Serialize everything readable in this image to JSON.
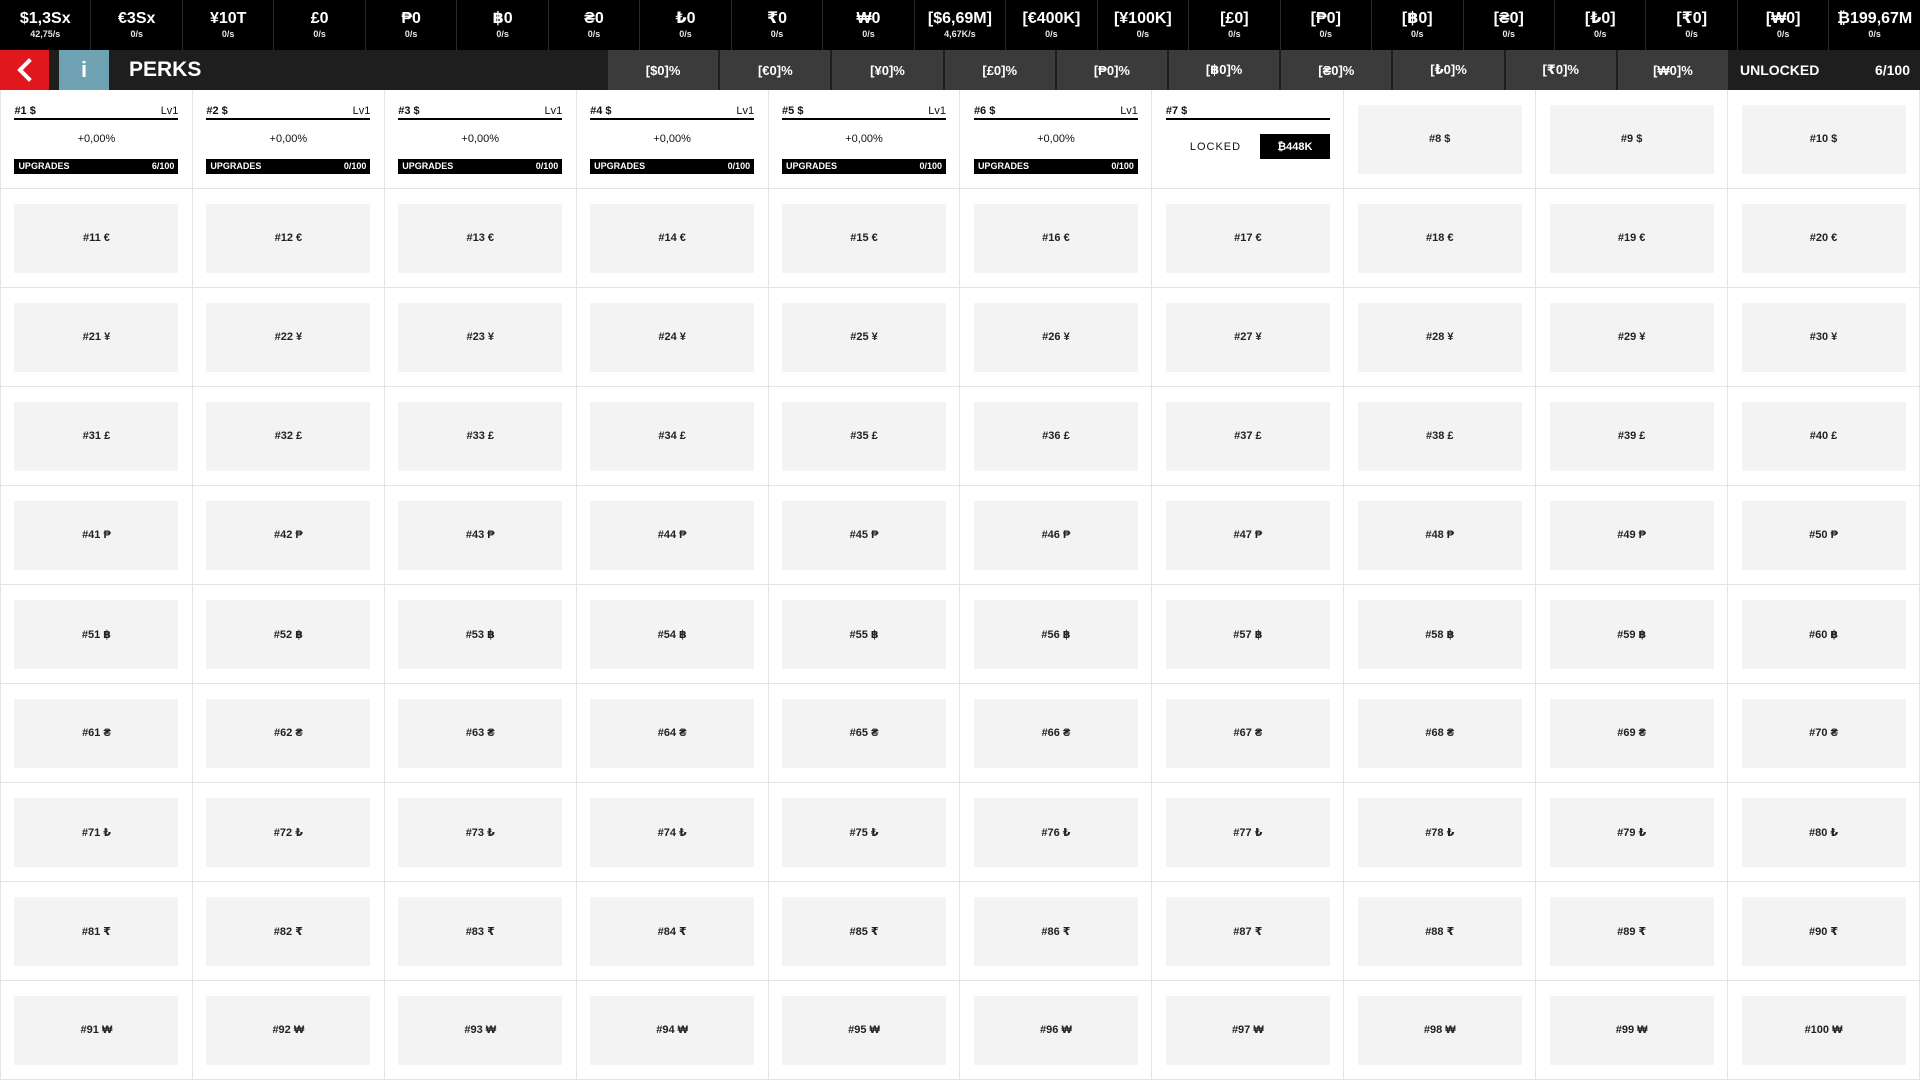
{
  "currencies": [
    {
      "amount": "$1,3Sx",
      "rate": "42,75/s"
    },
    {
      "amount": "€3Sx",
      "rate": "0/s"
    },
    {
      "amount": "¥10T",
      "rate": "0/s"
    },
    {
      "amount": "£0",
      "rate": "0/s"
    },
    {
      "amount": "₱0",
      "rate": "0/s"
    },
    {
      "amount": "฿0",
      "rate": "0/s"
    },
    {
      "amount": "₴0",
      "rate": "0/s"
    },
    {
      "amount": "₺0",
      "rate": "0/s"
    },
    {
      "amount": "₹0",
      "rate": "0/s"
    },
    {
      "amount": "₩0",
      "rate": "0/s"
    },
    {
      "amount": "[$6,69M]",
      "rate": "4,67K/s"
    },
    {
      "amount": "[€400K]",
      "rate": "0/s"
    },
    {
      "amount": "[¥100K]",
      "rate": "0/s"
    },
    {
      "amount": "[£0]",
      "rate": "0/s"
    },
    {
      "amount": "[₱0]",
      "rate": "0/s"
    },
    {
      "amount": "[฿0]",
      "rate": "0/s"
    },
    {
      "amount": "[₴0]",
      "rate": "0/s"
    },
    {
      "amount": "[₺0]",
      "rate": "0/s"
    },
    {
      "amount": "[₹0]",
      "rate": "0/s"
    },
    {
      "amount": "[₩0]",
      "rate": "0/s"
    },
    {
      "amount": "₿199,67M",
      "rate": "0/s"
    }
  ],
  "header": {
    "title": "PERKS",
    "info_label": "i",
    "percentages": [
      "[$0]%",
      "[€0]%",
      "[¥0]%",
      "[£0]%",
      "[₱0]%",
      "[฿0]%",
      "[₴0]%",
      "[₺0]%",
      "[₹0]%",
      "[₩0]%"
    ],
    "unlocked_label": "UNLOCKED",
    "unlocked_value": "6/100"
  },
  "perks": [
    {
      "label": "#1 $",
      "level": "Lv1",
      "bonus": "+0,00%",
      "upgrades_label": "UPGRADES",
      "upgrades": "6/100"
    },
    {
      "label": "#2 $",
      "level": "Lv1",
      "bonus": "+0,00%",
      "upgrades_label": "UPGRADES",
      "upgrades": "0/100"
    },
    {
      "label": "#3 $",
      "level": "Lv1",
      "bonus": "+0,00%",
      "upgrades_label": "UPGRADES",
      "upgrades": "0/100"
    },
    {
      "label": "#4 $",
      "level": "Lv1",
      "bonus": "+0,00%",
      "upgrades_label": "UPGRADES",
      "upgrades": "0/100"
    },
    {
      "label": "#5 $",
      "level": "Lv1",
      "bonus": "+0,00%",
      "upgrades_label": "UPGRADES",
      "upgrades": "0/100"
    },
    {
      "label": "#6 $",
      "level": "Lv1",
      "bonus": "+0,00%",
      "upgrades_label": "UPGRADES",
      "upgrades": "0/100"
    },
    {
      "label": "#7 $",
      "locked_label": "LOCKED",
      "cost": "₿448K"
    },
    {
      "label": "#8 $"
    },
    {
      "label": "#9 $"
    },
    {
      "label": "#10 $"
    },
    {
      "label": "#11 €"
    },
    {
      "label": "#12 €"
    },
    {
      "label": "#13 €"
    },
    {
      "label": "#14 €"
    },
    {
      "label": "#15 €"
    },
    {
      "label": "#16 €"
    },
    {
      "label": "#17 €"
    },
    {
      "label": "#18 €"
    },
    {
      "label": "#19 €"
    },
    {
      "label": "#20 €"
    },
    {
      "label": "#21 ¥"
    },
    {
      "label": "#22 ¥"
    },
    {
      "label": "#23 ¥"
    },
    {
      "label": "#24 ¥"
    },
    {
      "label": "#25 ¥"
    },
    {
      "label": "#26 ¥"
    },
    {
      "label": "#27 ¥"
    },
    {
      "label": "#28 ¥"
    },
    {
      "label": "#29 ¥"
    },
    {
      "label": "#30 ¥"
    },
    {
      "label": "#31 £"
    },
    {
      "label": "#32 £"
    },
    {
      "label": "#33 £"
    },
    {
      "label": "#34 £"
    },
    {
      "label": "#35 £"
    },
    {
      "label": "#36 £"
    },
    {
      "label": "#37 £"
    },
    {
      "label": "#38 £"
    },
    {
      "label": "#39 £"
    },
    {
      "label": "#40 £"
    },
    {
      "label": "#41 ₱"
    },
    {
      "label": "#42 ₱"
    },
    {
      "label": "#43 ₱"
    },
    {
      "label": "#44 ₱"
    },
    {
      "label": "#45 ₱"
    },
    {
      "label": "#46 ₱"
    },
    {
      "label": "#47 ₱"
    },
    {
      "label": "#48 ₱"
    },
    {
      "label": "#49 ₱"
    },
    {
      "label": "#50 ₱"
    },
    {
      "label": "#51 ฿"
    },
    {
      "label": "#52 ฿"
    },
    {
      "label": "#53 ฿"
    },
    {
      "label": "#54 ฿"
    },
    {
      "label": "#55 ฿"
    },
    {
      "label": "#56 ฿"
    },
    {
      "label": "#57 ฿"
    },
    {
      "label": "#58 ฿"
    },
    {
      "label": "#59 ฿"
    },
    {
      "label": "#60 ฿"
    },
    {
      "label": "#61 ₴"
    },
    {
      "label": "#62 ₴"
    },
    {
      "label": "#63 ₴"
    },
    {
      "label": "#64 ₴"
    },
    {
      "label": "#65 ₴"
    },
    {
      "label": "#66 ₴"
    },
    {
      "label": "#67 ₴"
    },
    {
      "label": "#68 ₴"
    },
    {
      "label": "#69 ₴"
    },
    {
      "label": "#70 ₴"
    },
    {
      "label": "#71 ₺"
    },
    {
      "label": "#72 ₺"
    },
    {
      "label": "#73 ₺"
    },
    {
      "label": "#74 ₺"
    },
    {
      "label": "#75 ₺"
    },
    {
      "label": "#76 ₺"
    },
    {
      "label": "#77 ₺"
    },
    {
      "label": "#78 ₺"
    },
    {
      "label": "#79 ₺"
    },
    {
      "label": "#80 ₺"
    },
    {
      "label": "#81 ₹"
    },
    {
      "label": "#82 ₹"
    },
    {
      "label": "#83 ₹"
    },
    {
      "label": "#84 ₹"
    },
    {
      "label": "#85 ₹"
    },
    {
      "label": "#86 ₹"
    },
    {
      "label": "#87 ₹"
    },
    {
      "label": "#88 ₹"
    },
    {
      "label": "#89 ₹"
    },
    {
      "label": "#90 ₹"
    },
    {
      "label": "#91 ₩"
    },
    {
      "label": "#92 ₩"
    },
    {
      "label": "#93 ₩"
    },
    {
      "label": "#94 ₩"
    },
    {
      "label": "#95 ₩"
    },
    {
      "label": "#96 ₩"
    },
    {
      "label": "#97 ₩"
    },
    {
      "label": "#98 ₩"
    },
    {
      "label": "#99 ₩"
    },
    {
      "label": "#100 ₩"
    }
  ],
  "colors": {
    "back_button": "#e1171e",
    "info_button": "#6fa3b4",
    "topbar": "#000000",
    "subbar": "#1e1e1e",
    "percent_bar": "#3b3b3b",
    "locked_cell": "#f3f3f3"
  },
  "icons": {
    "back": "chevron-left-icon",
    "info": "info-icon"
  }
}
